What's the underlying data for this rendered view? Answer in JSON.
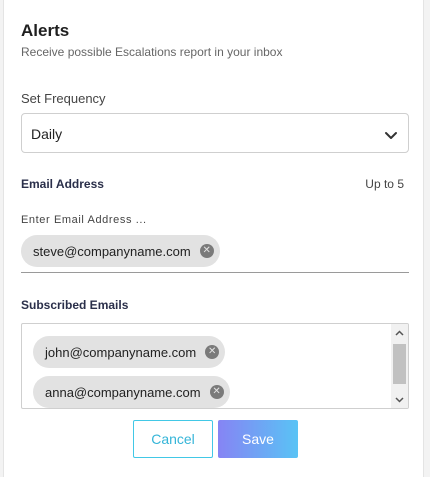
{
  "header": {
    "title": "Alerts",
    "subtitle": "Receive possible Escalations report in your inbox"
  },
  "frequency": {
    "label": "Set Frequency",
    "selected": "Daily",
    "icon": "chevron-down-icon"
  },
  "email_address": {
    "heading": "Email Address",
    "limit_text": "Up to 5",
    "input_label": "Enter Email Address ...",
    "chips": [
      "steve@companyname.com"
    ]
  },
  "subscribed": {
    "heading": "Subscribed Emails",
    "chips": [
      "john@companyname.com",
      "anna@companyname.com"
    ]
  },
  "actions": {
    "cancel_label": "Cancel",
    "save_label": "Save"
  },
  "colors": {
    "accent_cyan": "#42c8e6",
    "save_gradient_start": "#8684f4",
    "save_gradient_end": "#59c3f5",
    "chip_bg": "#e2e2e2"
  }
}
